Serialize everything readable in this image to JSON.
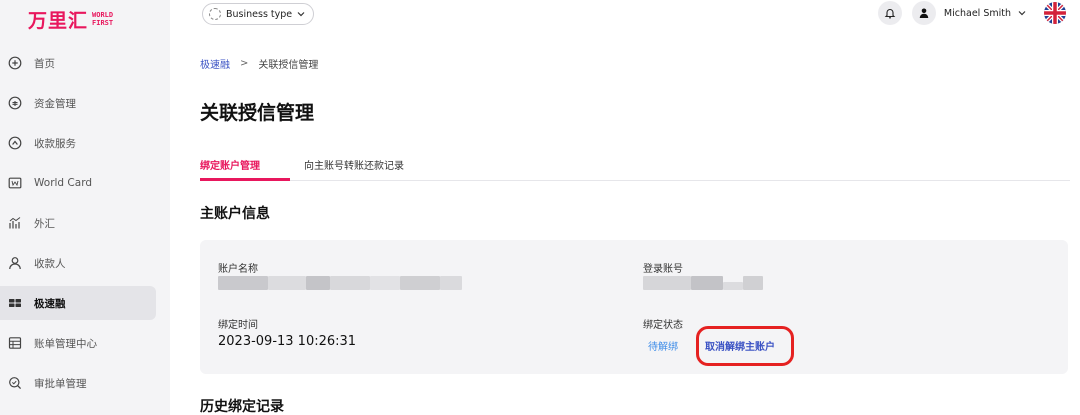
{
  "logo": {
    "cn": "万里汇",
    "en_line1": "WORLD",
    "en_line2": "FIRST"
  },
  "sidebar": {
    "items": [
      {
        "label": "首页",
        "icon": "plus-circle-icon",
        "active": false
      },
      {
        "label": "资金管理",
        "icon": "fund-icon",
        "active": false
      },
      {
        "label": "收款服务",
        "icon": "receive-icon",
        "active": false
      },
      {
        "label": "World Card",
        "icon": "card-icon",
        "active": false
      },
      {
        "label": "外汇",
        "icon": "fx-chart-icon",
        "active": false
      },
      {
        "label": "收款人",
        "icon": "payee-icon",
        "active": false
      },
      {
        "label": "极速融",
        "icon": "quick-finance-icon",
        "active": true
      },
      {
        "label": "账单管理中心",
        "icon": "bill-icon",
        "active": false
      },
      {
        "label": "审批单管理",
        "icon": "approval-search-icon",
        "active": false
      }
    ]
  },
  "topbar": {
    "business_type_label": "Business type",
    "user_name": "Michael Smith",
    "flag_icon": "uk-flag-icon"
  },
  "breadcrumb": {
    "parent": "极速融",
    "separator": ">",
    "current": "关联授信管理"
  },
  "page": {
    "title": "关联授信管理"
  },
  "tabs": [
    {
      "label": "绑定账户管理",
      "active": true
    },
    {
      "label": "向主账号转账还款记录",
      "active": false
    }
  ],
  "main_account": {
    "section_title": "主账户信息",
    "account_name_label": "账户名称",
    "login_account_label": "登录账号",
    "bind_time_label": "绑定时间",
    "bind_time_value": "2023-09-13 10:26:31",
    "bind_status_label": "绑定状态",
    "bind_status_value": "待解绑",
    "unbind_action": "取消解绑主账户"
  },
  "history": {
    "section_title": "历史绑定记录"
  },
  "colors": {
    "brand": "#e8175d",
    "link": "#3b52c4",
    "pending": "#3f8de8",
    "highlight": "#e52121",
    "sidebar_bg": "#f4f4f6",
    "card_bg": "#f4f4f6"
  }
}
